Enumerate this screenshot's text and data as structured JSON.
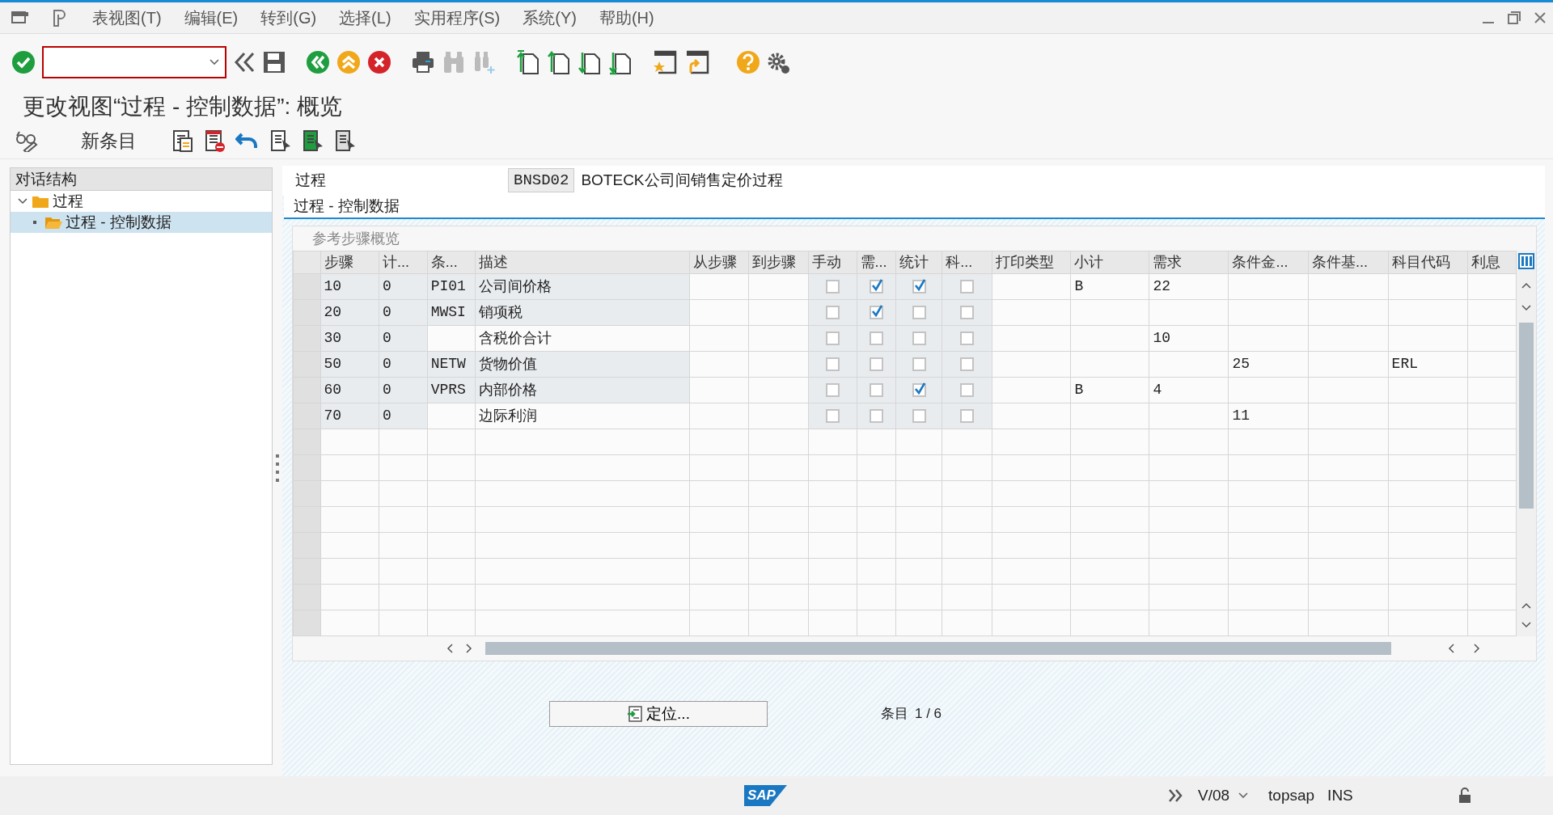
{
  "menu": [
    "表视图(T)",
    "编辑(E)",
    "转到(G)",
    "选择(L)",
    "实用程序(S)",
    "系统(Y)",
    "帮助(H)"
  ],
  "title": "更改视图“过程 - 控制数据”: 概览",
  "app_toolbar": {
    "new_entry": "新条目"
  },
  "tree": {
    "header": "对话结构",
    "items": [
      {
        "label": "过程",
        "expanded": true,
        "selected": false,
        "children": [
          {
            "label": "过程 - 控制数据",
            "selected": true
          }
        ]
      }
    ]
  },
  "header_field": {
    "label": "过程",
    "value": "BNSD02",
    "description": "BOTECK公司间销售定价过程"
  },
  "section_title": "过程 - 控制数据",
  "table": {
    "title": "参考步骤概览",
    "columns": [
      {
        "label": "步骤",
        "kind": "text",
        "readonly": true
      },
      {
        "label": "计...",
        "kind": "text",
        "readonly": true
      },
      {
        "label": "条...",
        "kind": "text"
      },
      {
        "label": "描述",
        "kind": "text"
      },
      {
        "label": "从步骤",
        "kind": "text",
        "readonly": false
      },
      {
        "label": "到步骤",
        "kind": "text",
        "readonly": false
      },
      {
        "label": "手动",
        "kind": "check",
        "readonly": true
      },
      {
        "label": "需...",
        "kind": "check",
        "readonly": true
      },
      {
        "label": "统计",
        "kind": "check",
        "readonly": true
      },
      {
        "label": "科...",
        "kind": "check",
        "readonly": true
      },
      {
        "label": "打印类型",
        "kind": "text",
        "readonly": false
      },
      {
        "label": "小计",
        "kind": "text",
        "readonly": false
      },
      {
        "label": "需求",
        "kind": "text",
        "readonly": false
      },
      {
        "label": "条件金...",
        "kind": "text",
        "readonly": false
      },
      {
        "label": "条件基...",
        "kind": "text",
        "readonly": false
      },
      {
        "label": "科目代码",
        "kind": "text",
        "readonly": false
      },
      {
        "label": "利息",
        "kind": "text",
        "readonly": false
      }
    ],
    "rows": [
      {
        "editable": false,
        "step": "10",
        "counter": "0",
        "cond_type": "PI01",
        "description": "公司间价格",
        "manual": false,
        "required": true,
        "statistical": true,
        "col_10": false,
        "subtotal": "B",
        "requirement": "22"
      },
      {
        "editable": false,
        "step": "20",
        "counter": "0",
        "cond_type": "MWSI",
        "description": "销项税",
        "manual": false,
        "required": true,
        "statistical": false,
        "col_10": false
      },
      {
        "editable": true,
        "step": "30",
        "counter": "0",
        "description": "含税价合计",
        "manual": false,
        "required": false,
        "statistical": false,
        "col_10": false,
        "requirement": "10"
      },
      {
        "editable": false,
        "step": "50",
        "counter": "0",
        "cond_type": "NETW",
        "description": "货物价值",
        "manual": false,
        "required": false,
        "statistical": false,
        "col_10": false,
        "cond_amount": "25",
        "account_key": "ERL"
      },
      {
        "editable": false,
        "step": "60",
        "counter": "0",
        "cond_type": "VPRS",
        "description": "内部价格",
        "manual": false,
        "required": false,
        "statistical": true,
        "col_10": false,
        "subtotal": "B",
        "requirement": "4"
      },
      {
        "editable": true,
        "step": "70",
        "counter": "0",
        "description": "边际利润",
        "manual": false,
        "required": false,
        "statistical": false,
        "col_10": false,
        "cond_amount": "11"
      }
    ]
  },
  "position_button": "定位...",
  "entry_count": {
    "label": "条目",
    "value": "1 / 6"
  },
  "status_bar": {
    "logo": "SAP",
    "system": "V/08",
    "server": "topsap",
    "mode": "INS"
  }
}
